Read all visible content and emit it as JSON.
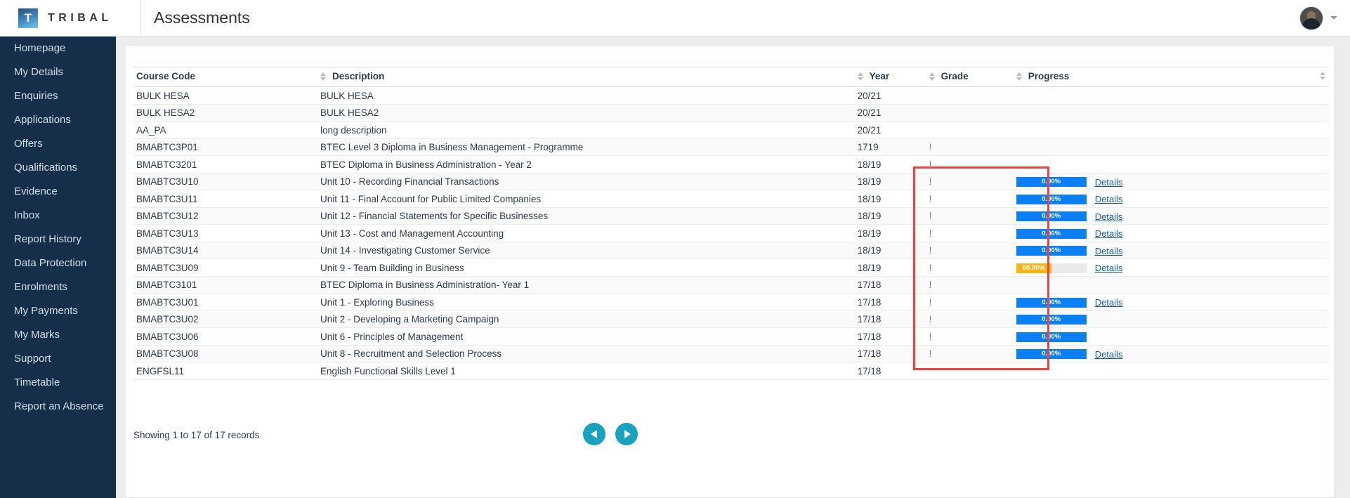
{
  "header": {
    "brand_letter": "T",
    "brand_name": "TRIBAL",
    "page_title": "Assessments"
  },
  "sidebar": {
    "items": [
      {
        "label": "Homepage"
      },
      {
        "label": "My Details"
      },
      {
        "label": "Enquiries"
      },
      {
        "label": "Applications"
      },
      {
        "label": "Offers"
      },
      {
        "label": "Qualifications"
      },
      {
        "label": "Evidence"
      },
      {
        "label": "Inbox"
      },
      {
        "label": "Report History"
      },
      {
        "label": "Data Protection"
      },
      {
        "label": "Enrolments"
      },
      {
        "label": "My Payments"
      },
      {
        "label": "My Marks"
      },
      {
        "label": "Support"
      },
      {
        "label": "Timetable"
      },
      {
        "label": "Report an Absence"
      }
    ]
  },
  "table": {
    "columns": [
      {
        "key": "code",
        "label": "Course Code",
        "sortable": true
      },
      {
        "key": "description",
        "label": "Description",
        "sortable": true
      },
      {
        "key": "year",
        "label": "Year",
        "sortable": true
      },
      {
        "key": "grade",
        "label": "Grade",
        "sortable": true
      },
      {
        "key": "progress",
        "label": "Progress",
        "sortable": true
      }
    ],
    "rows": [
      {
        "code": "BULK HESA",
        "indent": 0,
        "description": "BULK HESA",
        "year": "20/21",
        "grade": "",
        "progress": null,
        "details": false
      },
      {
        "code": "BULK HESA2",
        "indent": 1,
        "description": "BULK HESA2",
        "year": "20/21",
        "grade": "",
        "progress": null,
        "details": false
      },
      {
        "code": "AA_PA",
        "indent": 0,
        "description": "long description",
        "year": "20/21",
        "grade": "",
        "progress": null,
        "details": false
      },
      {
        "code": "BMABTC3P01",
        "indent": 0,
        "description": "BTEC Level 3 Diploma in Business Management - Programme",
        "year": "1719",
        "grade": "!",
        "progress": null,
        "details": false
      },
      {
        "code": "BMABTC3201",
        "indent": 1,
        "description": "BTEC Diploma in Business Administration - Year 2",
        "year": "18/19",
        "grade": "!",
        "progress": null,
        "details": false
      },
      {
        "code": "BMABTC3U10",
        "indent": 2,
        "description": "Unit 10 - Recording Financial Transactions",
        "year": "18/19",
        "grade": "!",
        "progress": "0.00%",
        "progress_value": 0,
        "details": true
      },
      {
        "code": "BMABTC3U11",
        "indent": 2,
        "description": "Unit 11 - Final Account for Public Limited Companies",
        "year": "18/19",
        "grade": "!",
        "progress": "0.00%",
        "progress_value": 0,
        "details": true
      },
      {
        "code": "BMABTC3U12",
        "indent": 2,
        "description": "Unit 12 - Financial Statements for Specific Businesses",
        "year": "18/19",
        "grade": "!",
        "progress": "0.00%",
        "progress_value": 0,
        "details": true
      },
      {
        "code": "BMABTC3U13",
        "indent": 2,
        "description": "Unit 13 - Cost and Management Accounting",
        "year": "18/19",
        "grade": "!",
        "progress": "0.00%",
        "progress_value": 0,
        "details": true
      },
      {
        "code": "BMABTC3U14",
        "indent": 2,
        "description": "Unit 14 - Investigating Customer Service",
        "year": "18/19",
        "grade": "!",
        "progress": "0.00%",
        "progress_value": 0,
        "details": true
      },
      {
        "code": "BMABTC3U09",
        "indent": 2,
        "description": "Unit 9 - Team Building in Business",
        "year": "18/19",
        "grade": "!",
        "progress": "50.00%",
        "progress_value": 50,
        "details": true
      },
      {
        "code": "BMABTC3101",
        "indent": 1,
        "description": "BTEC Diploma in Business Administration- Year 1",
        "year": "17/18",
        "grade": "!",
        "progress": null,
        "details": false
      },
      {
        "code": "BMABTC3U01",
        "indent": 2,
        "description": "Unit 1 - Exploring Business",
        "year": "17/18",
        "grade": "!",
        "progress": "0.00%",
        "progress_value": 0,
        "details": true
      },
      {
        "code": "BMABTC3U02",
        "indent": 2,
        "description": "Unit 2 - Developing a Marketing Campaign",
        "year": "17/18",
        "grade": "!",
        "progress": "0.00%",
        "progress_value": 0,
        "details": false
      },
      {
        "code": "BMABTC3U06",
        "indent": 2,
        "description": "Unit 6 - Principles of Management",
        "year": "17/18",
        "grade": "!",
        "progress": "0.00%",
        "progress_value": 0,
        "details": false
      },
      {
        "code": "BMABTC3U08",
        "indent": 2,
        "description": "Unit 8 - Recruitment and Selection Process",
        "year": "17/18",
        "grade": "!",
        "progress": "0.00%",
        "progress_value": 0,
        "details": true
      },
      {
        "code": "ENGFSL11",
        "indent": 0,
        "description": "English Functional Skills Level 1",
        "year": "17/18",
        "grade": "",
        "progress": null,
        "details": false
      }
    ],
    "details_label": "Details"
  },
  "footer": {
    "records_text": "Showing 1 to 17 of 17 records",
    "prev_label": "previous-page",
    "next_label": "next-page"
  },
  "colors": {
    "sidebar_bg": "#152e4a",
    "progress_blue": "#0b7ff5",
    "progress_amber": "#f7b418",
    "pager_teal": "#18a2c0",
    "highlight_red": "#f1413f",
    "link_blue": "#1a5b99"
  }
}
